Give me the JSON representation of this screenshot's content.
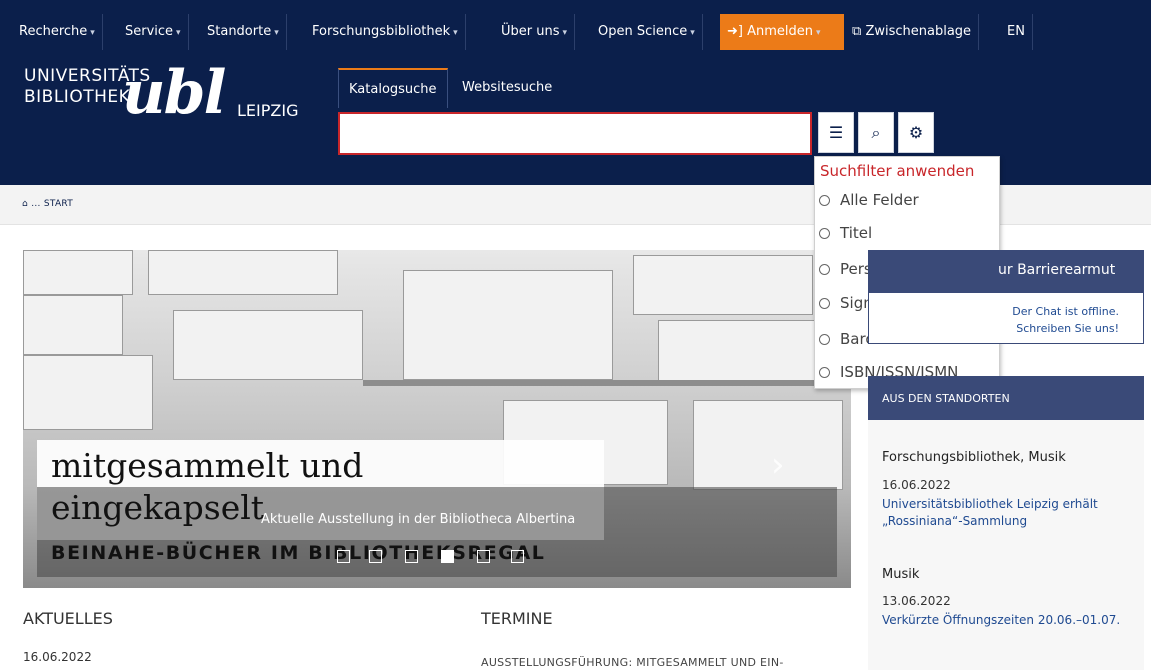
{
  "nav": {
    "items": [
      {
        "label": "Recherche",
        "caret": "▾"
      },
      {
        "label": "Service",
        "caret": "▾"
      },
      {
        "label": "Standorte",
        "caret": "▾"
      },
      {
        "label": "Forschungsbibliothek",
        "caret": "▾"
      },
      {
        "label": "Über uns",
        "caret": "▾"
      },
      {
        "label": "Open Science",
        "caret": "▾"
      }
    ],
    "login": {
      "icon": "sign-in-icon",
      "label": "Anmelden",
      "caret": "▾"
    },
    "clipboard": {
      "icon": "clipboard-icon",
      "label": "Zwischenablage"
    },
    "lang": "EN",
    "colors": {
      "bg": "#0b1f4b",
      "accent": "#ec7b18"
    }
  },
  "logo": {
    "line1": "UNIVERSITÄTS",
    "line2": "BIBLIOTHEK",
    "mark": "ubl",
    "city": "LEIPZIG"
  },
  "search": {
    "tabs": [
      {
        "label": "Katalogsuche"
      },
      {
        "label": "Websitesuche"
      }
    ],
    "value": "",
    "buttons": [
      "list-icon",
      "search-icon",
      "gear-icon"
    ],
    "dropdown": {
      "title": "Suchfilter anwenden",
      "options": [
        "Alle Felder",
        "Titel",
        "Person / Institution",
        "Signatur",
        "Barcode",
        "ISBN/ISSN/ISMN"
      ]
    }
  },
  "breadcrumb": {
    "home_icon": "home-icon",
    "label": "... START"
  },
  "hero": {
    "title_line1": "mitgesammelt und",
    "title_line2": "eingekapselt",
    "subtitle": "BEINAHE-BÜCHER IM BIBLIOTHEKSREGAL",
    "description": "Aktuelle Ausstellung in der Bibliotheca Albertina",
    "slides": 6,
    "active_slide": 4
  },
  "aktuelles": {
    "heading": "AKTUELLES",
    "date": "16.06.2022"
  },
  "termine": {
    "heading": "TERMINE",
    "first_event": "AUSSTELLUNGSFÜHRUNG: MITGESAMMELT UND EIN-"
  },
  "sidebar": {
    "barrier_title": "ur Barrierearmut",
    "chat_line1": "Der Chat ist offline.",
    "chat_line2": "Schreiben Sie uns!",
    "standorte_heading": "AUS DEN STANDORTEN",
    "news": [
      {
        "heading": "Forschungsbibliothek, Musik",
        "date": "16.06.2022",
        "link": "Universitätsbibliothek Leipzig erhält „Rossiniana“-Sammlung"
      },
      {
        "heading": "Musik",
        "date": "13.06.2022",
        "link": "Verkürzte Öffnungszeiten 20.06.–01.07."
      }
    ]
  }
}
